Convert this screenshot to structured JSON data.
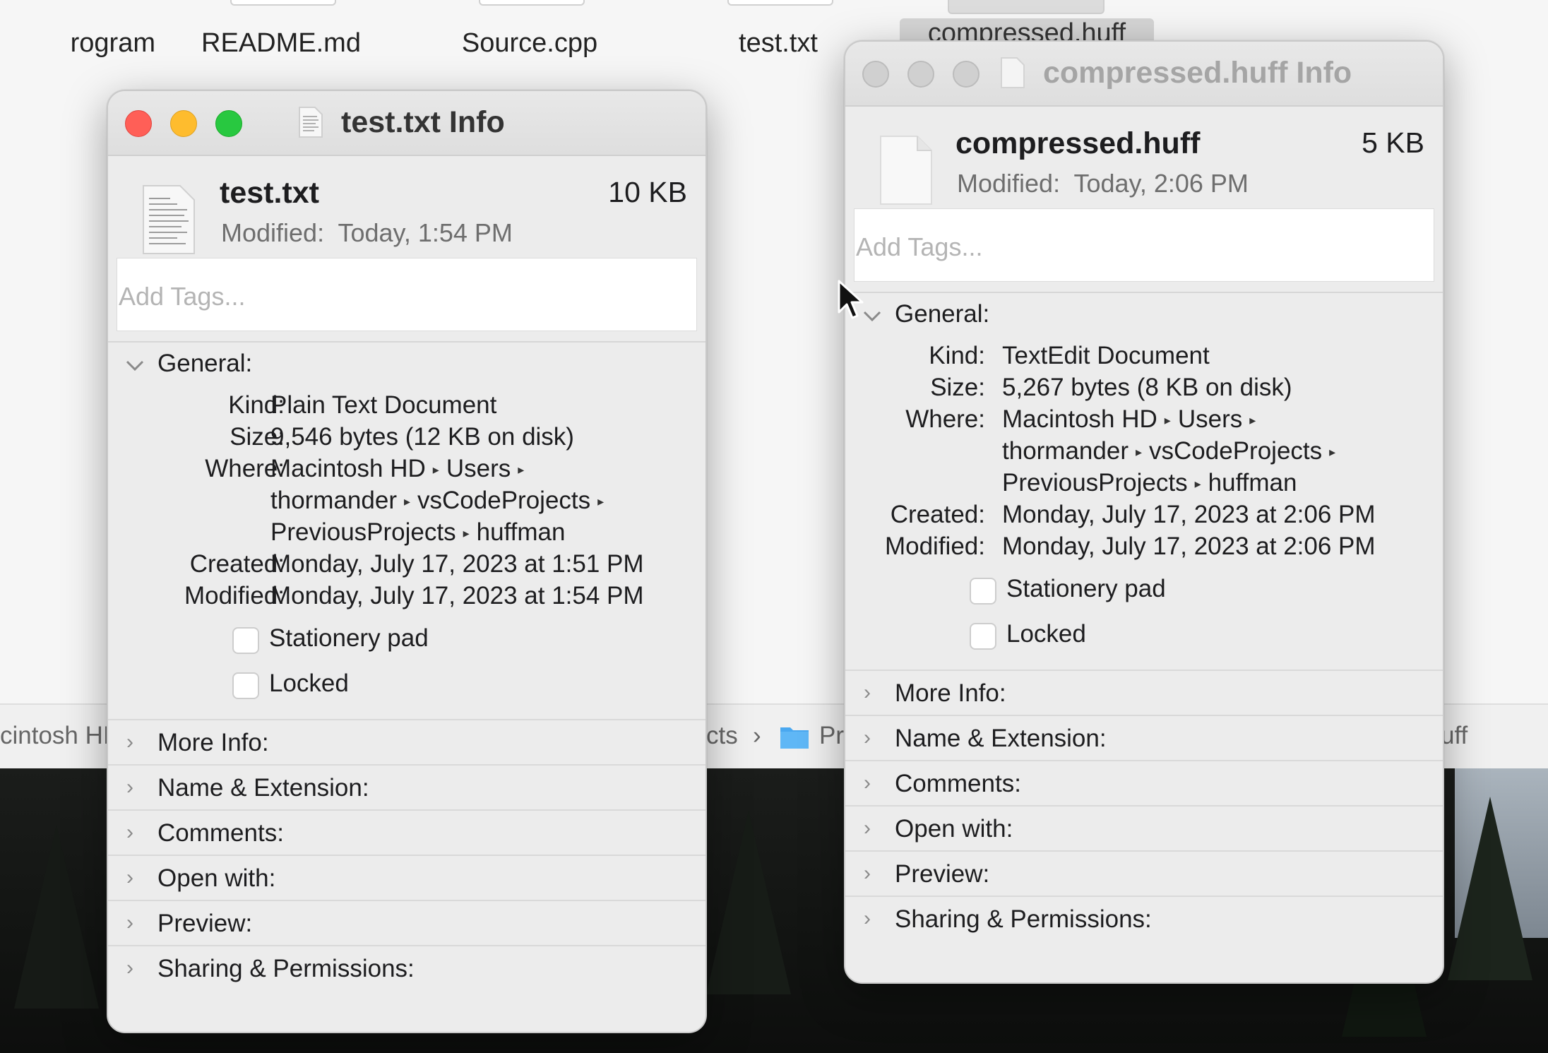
{
  "background": {
    "files": [
      {
        "name": "rogram"
      },
      {
        "name": "README.md"
      },
      {
        "name": "Source.cpp"
      },
      {
        "name": "test.txt"
      },
      {
        "name": "compressed.huff"
      }
    ],
    "pathbar": {
      "left": "cintosh HI",
      "middle": "cts",
      "sep": "›",
      "folder": "Pr",
      "right": "uff"
    }
  },
  "windows": {
    "test": {
      "title": "test.txt Info",
      "file_name": "test.txt",
      "size": "10 KB",
      "modified_label": "Modified:",
      "modified_value": "Today, 1:54 PM",
      "tags_placeholder": "Add Tags...",
      "general_label": "General:",
      "kind_label": "Kind:",
      "kind_value": "Plain Text Document",
      "size_label": "Size:",
      "size_value": "9,546 bytes (12 KB on disk)",
      "where_label": "Where:",
      "where_line1": [
        "Macintosh HD",
        "Users"
      ],
      "where_line2": [
        "thormander",
        "vsCodeProjects"
      ],
      "where_line3": [
        "PreviousProjects",
        "huffman"
      ],
      "created_label": "Created:",
      "created_value": "Monday, July 17, 2023 at 1:51 PM",
      "modified_full_label": "Modified:",
      "modified_full_value": "Monday, July 17, 2023 at 1:54 PM",
      "stationery_label": "Stationery pad",
      "locked_label": "Locked",
      "sections": [
        "More Info:",
        "Name & Extension:",
        "Comments:",
        "Open with:",
        "Preview:",
        "Sharing & Permissions:"
      ]
    },
    "huff": {
      "title": "compressed.huff Info",
      "file_name": "compressed.huff",
      "size": "5 KB",
      "modified_label": "Modified:",
      "modified_value": "Today, 2:06 PM",
      "tags_placeholder": "Add Tags...",
      "general_label": "General:",
      "kind_label": "Kind:",
      "kind_value": "TextEdit Document",
      "size_label": "Size:",
      "size_value": "5,267 bytes (8 KB on disk)",
      "where_label": "Where:",
      "where_line1": [
        "Macintosh HD",
        "Users"
      ],
      "where_line2": [
        "thormander",
        "vsCodeProjects"
      ],
      "where_line3": [
        "PreviousProjects",
        "huffman"
      ],
      "created_label": "Created:",
      "created_value": "Monday, July 17, 2023 at 2:06 PM",
      "modified_full_label": "Modified:",
      "modified_full_value": "Monday, July 17, 2023 at 2:06 PM",
      "stationery_label": "Stationery pad",
      "locked_label": "Locked",
      "sections": [
        "More Info:",
        "Name & Extension:",
        "Comments:",
        "Open with:",
        "Preview:",
        "Sharing & Permissions:"
      ]
    }
  },
  "arrow_glyph": "▸",
  "chevron_down": "⌄",
  "chevron_right": "›",
  "colors": {
    "close": "#ff5f57",
    "minimize": "#febc2e",
    "zoom": "#28c840",
    "folder_blue": "#4aa8f0"
  },
  "icons": {
    "traffic_close": "close-icon",
    "traffic_minimize": "minimize-icon",
    "traffic_zoom": "zoom-icon",
    "document": "document-icon",
    "folder": "folder-icon",
    "cursor": "cursor-icon"
  }
}
